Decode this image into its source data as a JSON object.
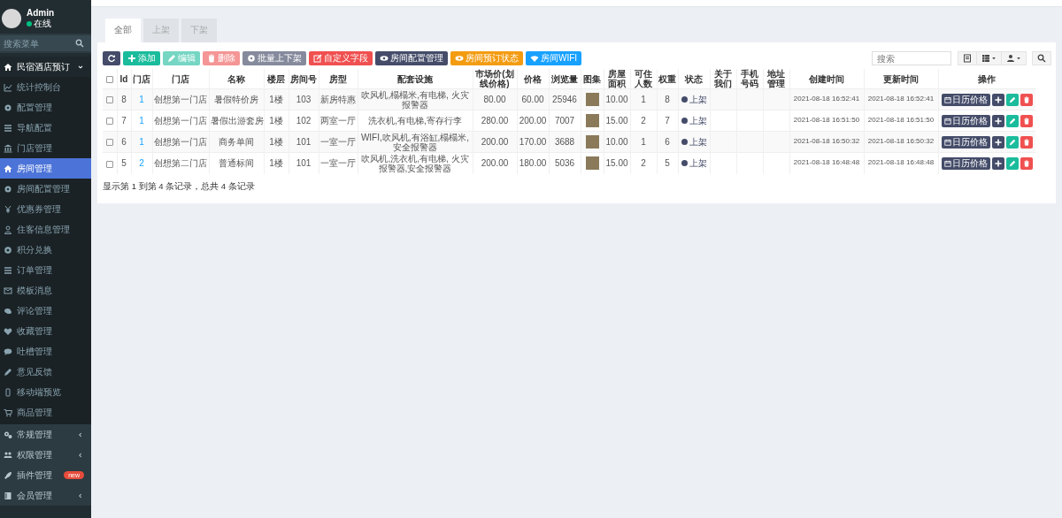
{
  "user": {
    "name": "Admin",
    "status": "在线"
  },
  "menu_search": {
    "placeholder": "搜索菜单"
  },
  "sidebar": {
    "items": [
      {
        "label": "民宿酒店预订",
        "expanded": true,
        "selected": false,
        "children": [
          {
            "label": "统计控制台",
            "selected": false
          },
          {
            "label": "配置管理",
            "selected": false
          },
          {
            "label": "导航配置",
            "selected": false
          },
          {
            "label": "门店管理",
            "selected": false
          },
          {
            "label": "房间管理",
            "selected": true
          },
          {
            "label": "房间配置管理",
            "selected": false
          },
          {
            "label": "优惠券管理",
            "selected": false
          },
          {
            "label": "住客信息管理",
            "selected": false
          },
          {
            "label": "积分兑换",
            "selected": false
          },
          {
            "label": "订单管理",
            "selected": false
          },
          {
            "label": "模板消息",
            "selected": false
          },
          {
            "label": "评论管理",
            "selected": false
          },
          {
            "label": "收藏管理",
            "selected": false
          },
          {
            "label": "吐槽管理",
            "selected": false
          },
          {
            "label": "意见反馈",
            "selected": false
          },
          {
            "label": "移动端预览",
            "selected": false
          },
          {
            "label": "商品管理",
            "selected": false
          }
        ]
      },
      {
        "label": "常规管理",
        "expanded": false,
        "selected": false
      },
      {
        "label": "权限管理",
        "expanded": false,
        "selected": false
      },
      {
        "label": "插件管理",
        "selected": false,
        "badge": "new"
      },
      {
        "label": "会员管理",
        "expanded": false,
        "selected": false
      }
    ]
  },
  "tabs": [
    {
      "label": "全部",
      "selected": true
    },
    {
      "label": "上架",
      "selected": false
    },
    {
      "label": "下架",
      "selected": false
    }
  ],
  "toolbar": [
    {
      "kind": "refresh",
      "disabled": false
    },
    {
      "kind": "add",
      "label": "添加",
      "disabled": false
    },
    {
      "kind": "edit",
      "label": "编辑",
      "disabled": true
    },
    {
      "kind": "delete",
      "label": "删除",
      "disabled": true
    },
    {
      "kind": "batch",
      "label": "批量上下架",
      "disabled": false
    },
    {
      "kind": "custom",
      "label": "自定义字段",
      "disabled": false
    },
    {
      "kind": "config",
      "label": "房间配置管理",
      "disabled": false
    },
    {
      "kind": "status",
      "label": "房间预订状态",
      "disabled": false
    },
    {
      "kind": "wifi",
      "label": "房间WIFI",
      "disabled": false
    }
  ],
  "table_search": {
    "placeholder": "搜索"
  },
  "table": {
    "all_checked": false,
    "columns": [
      "Id",
      "门店",
      "门店",
      "名称",
      "楼层",
      "房间号",
      "房型",
      "配套设施",
      "市场价(划线价格)",
      "价格",
      "浏览量",
      "图集",
      "房屋面积",
      "可住人数",
      "权重",
      "状态",
      "关于我们",
      "手机号码",
      "地址管理",
      "创建时间",
      "更新时间",
      "操作"
    ],
    "rows": [
      {
        "checked": false,
        "cells": [
          "8",
          "1",
          "创想第一门店",
          "暑假特价房",
          "1楼",
          "103",
          "新房特惠",
          "吹风机,榻榻米,有电梯, 火灾报警器",
          "80.00",
          "60.00",
          "25946",
          "",
          "10.00",
          "1",
          "8",
          "上架",
          "",
          "",
          "",
          "2021-08-18 16:52:41",
          "2021-08-18 16:52:41"
        ],
        "action": "日历价格"
      },
      {
        "checked": false,
        "cells": [
          "7",
          "1",
          "创想第一门店",
          "暑假出游套房",
          "1楼",
          "102",
          "两室一厅",
          "洗衣机,有电梯,寄存行李",
          "280.00",
          "200.00",
          "7007",
          "",
          "15.00",
          "2",
          "7",
          "上架",
          "",
          "",
          "",
          "2021-08-18 16:51:50",
          "2021-08-18 16:51:50"
        ],
        "action": "日历价格"
      },
      {
        "checked": false,
        "cells": [
          "6",
          "1",
          "创想第一门店",
          "商务单间",
          "1楼",
          "101",
          "一室一厅",
          "WIFI,吹风机,有浴缸,榻榻米,安全报警器",
          "200.00",
          "170.00",
          "3688",
          "",
          "10.00",
          "1",
          "6",
          "上架",
          "",
          "",
          "",
          "2021-08-18 16:50:32",
          "2021-08-18 16:50:32"
        ],
        "action": "日历价格"
      },
      {
        "checked": false,
        "cells": [
          "5",
          "2",
          "创想第二门店",
          "普通标间",
          "1楼",
          "101",
          "一室一厅",
          "吹风机,洗衣机,有电梯, 火灾报警器,安全报警器",
          "200.00",
          "180.00",
          "5036",
          "",
          "15.00",
          "2",
          "5",
          "上架",
          "",
          "",
          "",
          "2021-08-18 16:48:48",
          "2021-08-18 16:48:48"
        ],
        "action": "日历价格"
      }
    ]
  },
  "pagination_info": "显示第 1 到第 4 条记录，总共 4 条记录"
}
